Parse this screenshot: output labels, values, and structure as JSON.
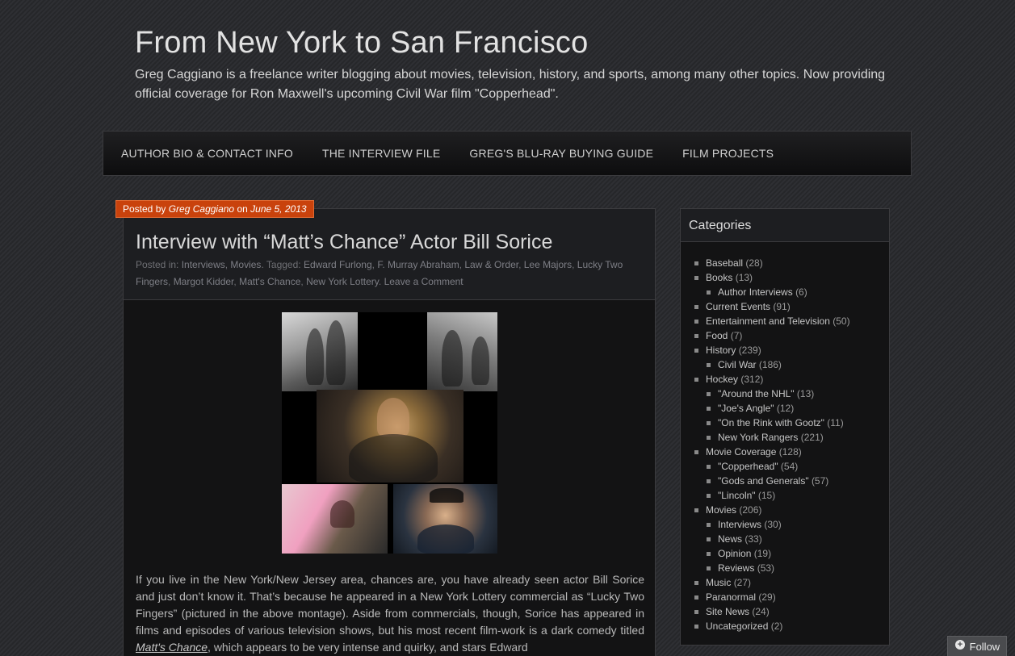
{
  "site": {
    "title": "From New York to San Francisco",
    "description": "Greg Caggiano is a freelance writer blogging about movies, television, history, and sports, among many other topics. Now providing official coverage for Ron Maxwell's upcoming Civil War film \"Copperhead\"."
  },
  "nav": {
    "items": [
      "AUTHOR BIO & CONTACT INFO",
      "THE INTERVIEW FILE",
      "GREG'S BLU-RAY BUYING GUIDE",
      "FILM PROJECTS"
    ]
  },
  "post": {
    "posted_by_prefix": "Posted by",
    "author": "Greg Caggiano",
    "on": "on",
    "date": "June 5, 2013",
    "title": "Interview with “Matt’s Chance” Actor Bill Sorice",
    "meta": {
      "posted_in_label": "Posted in:",
      "categories": [
        "Interviews",
        "Movies"
      ],
      "tagged_label": "Tagged:",
      "tags": [
        "Edward Furlong",
        "F. Murray Abraham",
        "Law & Order",
        "Lee Majors",
        "Lucky Two Fingers",
        "Margot Kidder",
        "Matt's Chance",
        "New York Lottery"
      ],
      "comment_link": "Leave a Comment"
    },
    "body_before": "If you live in the New York/New Jersey area, chances are, you have already seen actor Bill Sorice and just don’t know it. That’s because he appeared in a New York Lottery commercial as “Lucky Two Fingers” (pictured in the above montage). Aside from commercials, though, Sorice has appeared in films and episodes of various television shows, but his most recent film-work is a dark comedy titled ",
    "body_link": "Matt's Chance",
    "body_after": ", which appears to be very intense and quirky, and stars Edward"
  },
  "sidebar": {
    "title": "Categories",
    "categories": [
      {
        "name": "Baseball",
        "count": "(28)",
        "sub": false
      },
      {
        "name": "Books",
        "count": "(13)",
        "sub": false
      },
      {
        "name": "Author Interviews",
        "count": "(6)",
        "sub": true
      },
      {
        "name": "Current Events",
        "count": "(91)",
        "sub": false
      },
      {
        "name": "Entertainment and Television",
        "count": "(50)",
        "sub": false
      },
      {
        "name": "Food",
        "count": "(7)",
        "sub": false
      },
      {
        "name": "History",
        "count": "(239)",
        "sub": false
      },
      {
        "name": "Civil War",
        "count": "(186)",
        "sub": true
      },
      {
        "name": "Hockey",
        "count": "(312)",
        "sub": false
      },
      {
        "name": "\"Around the NHL\"",
        "count": "(13)",
        "sub": true
      },
      {
        "name": "\"Joe's Angle\"",
        "count": "(12)",
        "sub": true
      },
      {
        "name": "\"On the Rink with Gootz\"",
        "count": "(11)",
        "sub": true
      },
      {
        "name": "New York Rangers",
        "count": "(221)",
        "sub": true
      },
      {
        "name": "Movie Coverage",
        "count": "(128)",
        "sub": false
      },
      {
        "name": "\"Copperhead\"",
        "count": "(54)",
        "sub": true
      },
      {
        "name": "\"Gods and Generals\"",
        "count": "(57)",
        "sub": true
      },
      {
        "name": "\"Lincoln\"",
        "count": "(15)",
        "sub": true
      },
      {
        "name": "Movies",
        "count": "(206)",
        "sub": false
      },
      {
        "name": "Interviews",
        "count": "(30)",
        "sub": true
      },
      {
        "name": "News",
        "count": "(33)",
        "sub": true
      },
      {
        "name": "Opinion",
        "count": "(19)",
        "sub": true
      },
      {
        "name": "Reviews",
        "count": "(53)",
        "sub": true
      },
      {
        "name": "Music",
        "count": "(27)",
        "sub": false
      },
      {
        "name": "Paranormal",
        "count": "(29)",
        "sub": false
      },
      {
        "name": "Site News",
        "count": "(24)",
        "sub": false
      },
      {
        "name": "Uncategorized",
        "count": "(2)",
        "sub": false
      }
    ]
  },
  "follow": {
    "label": "Follow",
    "icon": "plus-circle-icon"
  }
}
